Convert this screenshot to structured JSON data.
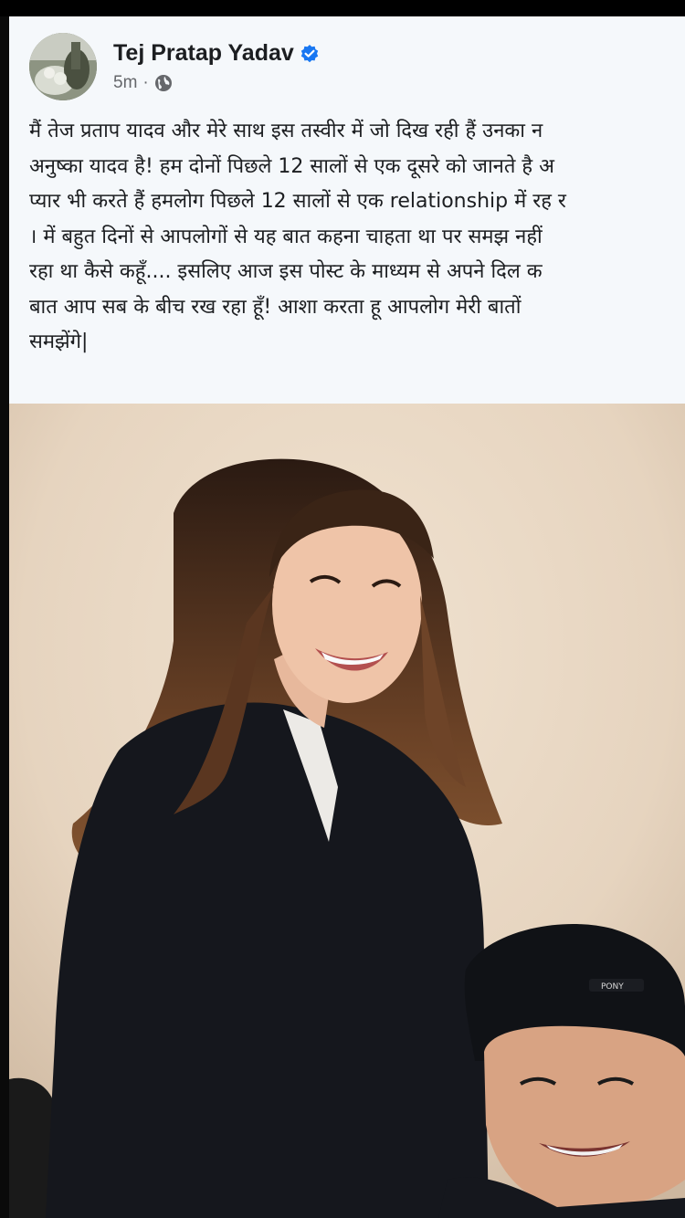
{
  "post": {
    "author": "Tej Pratap Yadav",
    "timestamp": "5m",
    "separator": "·",
    "audience_icon": "globe-icon",
    "verified_icon": "verified-badge-icon",
    "text_lines": [
      "मैं तेज प्रताप यादव और  मेरे साथ इस तस्वीर में जो दिख रही हैं उनका न",
      "अनुष्का यादव है! हम दोनों पिछले 12 सालों से एक दूसरे को जानते है अ",
      "प्यार भी करते हैं हमलोग पिछले 12 सालों से एक relationship में रह र",
      "। में बहुत दिनों से आपलोगों से यह बात कहना चाहता था पर समझ नहीं",
      "रहा था कैसे कहूँ.... इसलिए आज इस पोस्ट के माध्यम से अपने दिल क",
      "बात आप सब के बीच रख रहा हूँ! आशा करता हू आपलोग मेरी बातों",
      "समझेंगे|"
    ]
  },
  "photo": {
    "cap_logo_text": "PONY"
  },
  "colors": {
    "card_bg": "#f5f8fb",
    "verified_blue": "#1877f2",
    "meta_gray": "#65676b",
    "wall": "#e8d8c6"
  }
}
